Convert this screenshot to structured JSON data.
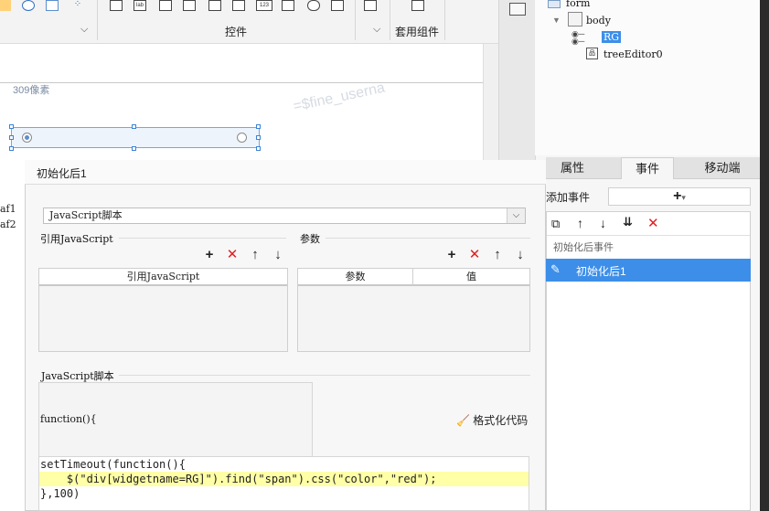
{
  "ribbon": {
    "controls_label": "控件",
    "widgets_label": "套用组件",
    "small_icon_labels": [
      "lab",
      "123"
    ]
  },
  "canvas": {
    "pixel_label": "309像素",
    "watermark": "=$fine_userna",
    "left_labels": [
      "af1",
      "af2"
    ]
  },
  "tree": {
    "form": "form",
    "body": "body",
    "rg": "RG",
    "tree_editor": "treeEditor0"
  },
  "right_tabs": [
    "属性",
    "事件",
    "移动端"
  ],
  "events": {
    "add_label": "添加事件",
    "add_symbol": "+",
    "add_dropdown": "▾",
    "section_label": "初始化后事件",
    "selected_item": "初始化后1"
  },
  "dialog": {
    "title": "初始化后1",
    "type_select": "JavaScript脚本",
    "ref_js_label": "引用JavaScript",
    "params_label": "参数",
    "ref_js_column": "引用JavaScript",
    "params_columns": [
      "参数",
      "值"
    ],
    "script_label": "JavaScript脚本",
    "function_header": "function(){",
    "format_button": "格式化代码",
    "code_lines": [
      "setTimeout(function(){",
      "    $(\"div[widgetname=RG]\").find(\"span\").css(\"color\",\"red\");",
      "},100)"
    ]
  },
  "colors": {
    "accent": "#3c8ee8",
    "delete": "#e02020",
    "highlight": "#ffffa8"
  }
}
